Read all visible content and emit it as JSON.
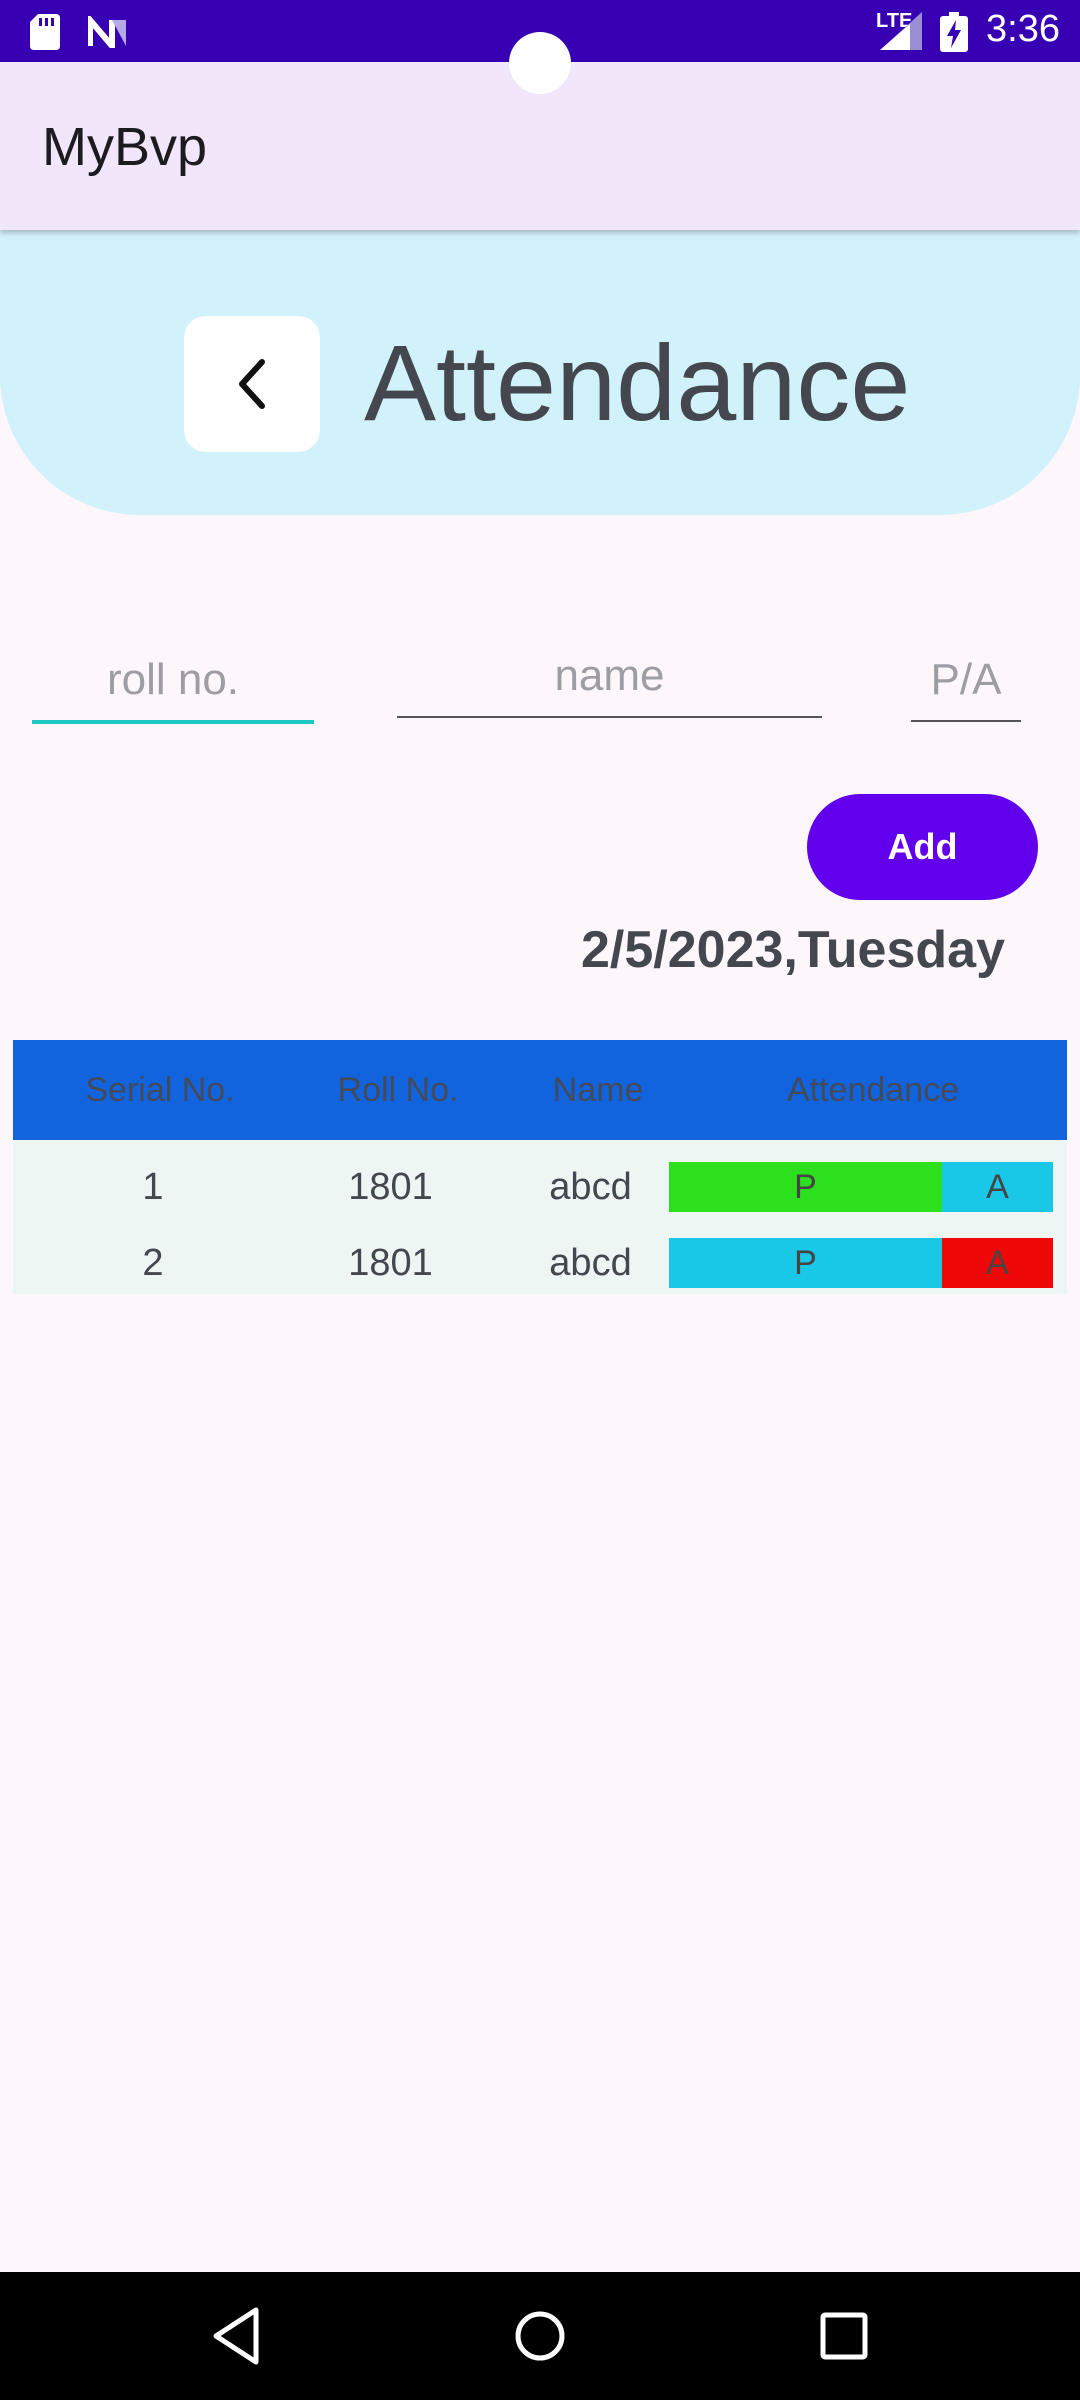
{
  "status_bar": {
    "time": "3:36",
    "network": "LTE",
    "icons": [
      "sd-card-icon",
      "n-notification-icon",
      "signal-icon",
      "battery-charging-icon"
    ]
  },
  "app_bar": {
    "title": "MyBvp"
  },
  "header": {
    "title": "Attendance",
    "back_icon": "chevron-left-icon"
  },
  "form": {
    "roll_placeholder": "roll no.",
    "name_placeholder": "name",
    "pa_placeholder": "P/A",
    "add_label": "Add"
  },
  "date": "2/5/2023,Tuesday",
  "table": {
    "headers": [
      "Serial No.",
      "Roll No.",
      "Name",
      "Attendance"
    ],
    "rows": [
      {
        "serial": "1",
        "roll": "1801",
        "name": "abcd",
        "p_label": "P",
        "a_label": "A",
        "p_color": "#2de01e",
        "a_color": "#19c8e6"
      },
      {
        "serial": "2",
        "roll": "1801",
        "name": "abcd",
        "p_label": "P",
        "a_label": "A",
        "p_color": "#19c8e6",
        "a_color": "#ee0707"
      }
    ]
  },
  "colors": {
    "status_bar": "#3700b3",
    "app_bar": "#f2e6fb",
    "banner": "#d1f1fb",
    "accent": "#6200ee",
    "table_header": "#1163de",
    "focus_underline": "#1fc6c3"
  },
  "nav_bar": {
    "icons": [
      "nav-back-icon",
      "nav-home-icon",
      "nav-recents-icon"
    ]
  }
}
